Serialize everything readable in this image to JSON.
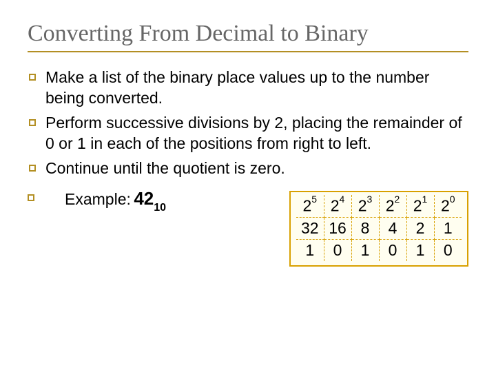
{
  "title": "Converting From Decimal to Binary",
  "bullets": [
    "Make a list of the binary place values up to the number being converted.",
    "Perform successive divisions by 2, placing the remainder of 0 or 1 in each of the positions from right to left.",
    "Continue until the quotient is zero."
  ],
  "example": {
    "label": "Example:",
    "value": "42",
    "subscript": "10"
  },
  "table": {
    "powers": [
      {
        "base": "2",
        "exp": "5"
      },
      {
        "base": "2",
        "exp": "4"
      },
      {
        "base": "2",
        "exp": "3"
      },
      {
        "base": "2",
        "exp": "2"
      },
      {
        "base": "2",
        "exp": "1"
      },
      {
        "base": "2",
        "exp": "0"
      }
    ],
    "place_values": [
      "32",
      "16",
      "8",
      "4",
      "2",
      "1"
    ],
    "bits": [
      "1",
      "0",
      "1",
      "0",
      "1",
      "0"
    ]
  }
}
